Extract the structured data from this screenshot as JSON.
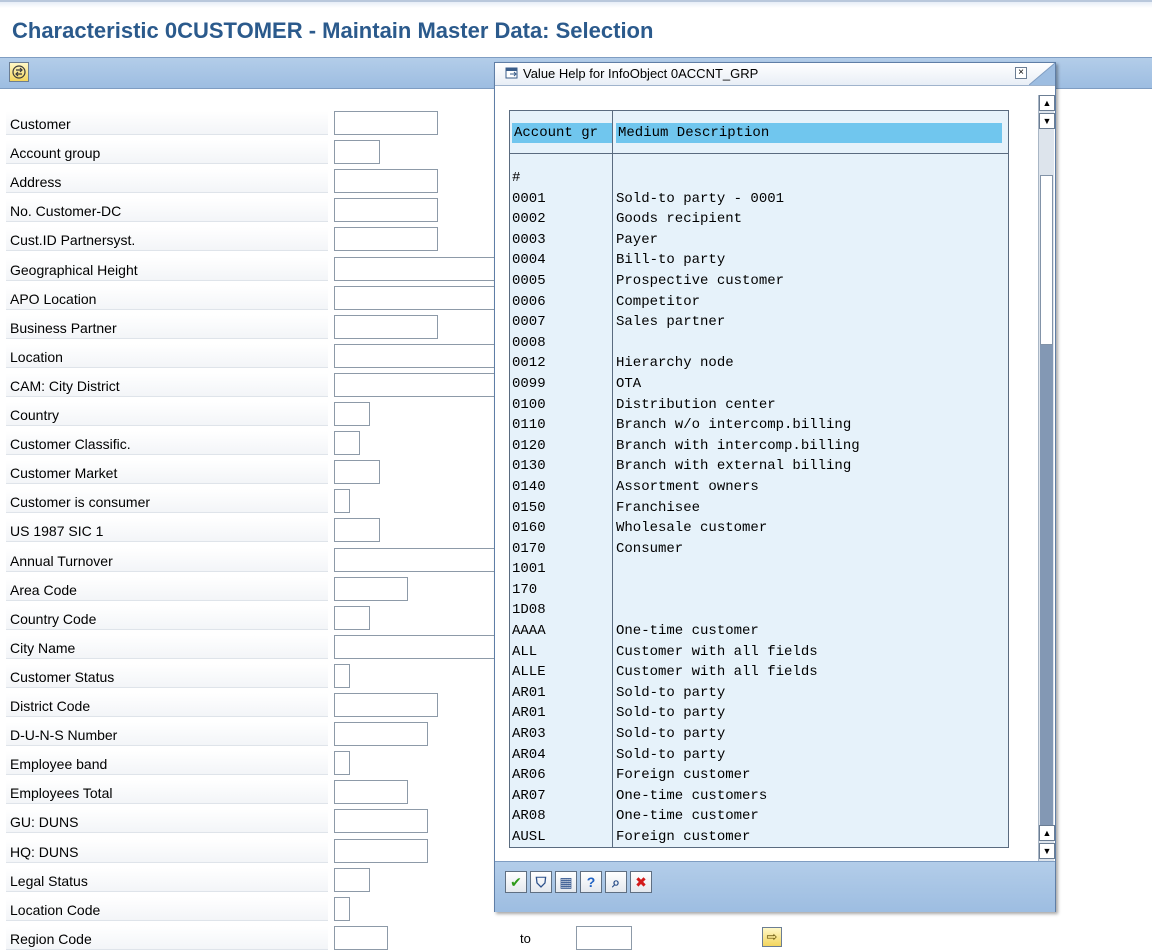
{
  "page": {
    "title": "Characteristic 0CUSTOMER - Maintain Master Data: Selection"
  },
  "toolbar": {
    "execute_icon": "execute-icon"
  },
  "fields": [
    {
      "label": "Customer",
      "w": 104
    },
    {
      "label": "Account group",
      "w": 46
    },
    {
      "label": "Address",
      "w": 104
    },
    {
      "label": "No. Customer-DC",
      "w": 104
    },
    {
      "label": "Cust.ID Partnersyst.",
      "w": 104
    },
    {
      "label": "Geographical Height",
      "w": 170
    },
    {
      "label": "APO Location",
      "w": 170
    },
    {
      "label": "Business Partner",
      "w": 104
    },
    {
      "label": "Location",
      "w": 170
    },
    {
      "label": "CAM: City District",
      "w": 170
    },
    {
      "label": "Country",
      "w": 36
    },
    {
      "label": "Customer Classific.",
      "w": 26
    },
    {
      "label": "Customer Market",
      "w": 46
    },
    {
      "label": "Customer is consumer",
      "w": 16
    },
    {
      "label": "US 1987 SIC 1",
      "w": 46
    },
    {
      "label": "Annual Turnover",
      "w": 170
    },
    {
      "label": "Area Code",
      "w": 74
    },
    {
      "label": "Country Code",
      "w": 36
    },
    {
      "label": "City Name",
      "w": 170
    },
    {
      "label": "Customer Status",
      "w": 16
    },
    {
      "label": "District Code",
      "w": 104
    },
    {
      "label": "D-U-N-S Number",
      "w": 94
    },
    {
      "label": "Employee band",
      "w": 16
    },
    {
      "label": "Employees Total",
      "w": 74
    },
    {
      "label": "GU: DUNS",
      "w": 94
    },
    {
      "label": "HQ: DUNS",
      "w": 94
    },
    {
      "label": "Legal Status",
      "w": 36
    },
    {
      "label": "Location Code",
      "w": 16
    },
    {
      "label": "Region Code",
      "w": 54
    }
  ],
  "region_row": {
    "to_label": "to"
  },
  "dialog": {
    "title": "Value Help for InfoObject 0ACCNT_GRP",
    "close_icon": "close-icon",
    "col1_header": "Account gr",
    "col2_header": "Medium Description",
    "rows": [
      {
        "code": "#",
        "desc": ""
      },
      {
        "code": "0001",
        "desc": "Sold-to party - 0001"
      },
      {
        "code": "0002",
        "desc": "Goods recipient"
      },
      {
        "code": "0003",
        "desc": "Payer"
      },
      {
        "code": "0004",
        "desc": "Bill-to party"
      },
      {
        "code": "0005",
        "desc": "Prospective customer"
      },
      {
        "code": "0006",
        "desc": "Competitor"
      },
      {
        "code": "0007",
        "desc": "Sales partner"
      },
      {
        "code": "0008",
        "desc": ""
      },
      {
        "code": "0012",
        "desc": "Hierarchy node"
      },
      {
        "code": "0099",
        "desc": "OTA"
      },
      {
        "code": "0100",
        "desc": "Distribution center"
      },
      {
        "code": "0110",
        "desc": "Branch w/o intercomp.billing"
      },
      {
        "code": "0120",
        "desc": "Branch with intercomp.billing"
      },
      {
        "code": "0130",
        "desc": "Branch with external billing"
      },
      {
        "code": "0140",
        "desc": "Assortment owners"
      },
      {
        "code": "0150",
        "desc": "Franchisee"
      },
      {
        "code": "0160",
        "desc": "Wholesale customer"
      },
      {
        "code": "0170",
        "desc": "Consumer"
      },
      {
        "code": "1001",
        "desc": ""
      },
      {
        "code": "170",
        "desc": ""
      },
      {
        "code": "1D08",
        "desc": ""
      },
      {
        "code": "AAAA",
        "desc": "One-time customer"
      },
      {
        "code": "ALL",
        "desc": "Customer with all fields"
      },
      {
        "code": "ALLE",
        "desc": "Customer with all fields"
      },
      {
        "code": "AR01",
        "desc": "Sold-to party"
      },
      {
        "code": "AR01",
        "desc": "Sold-to party"
      },
      {
        "code": "AR03",
        "desc": "Sold-to party"
      },
      {
        "code": "AR04",
        "desc": "Sold-to party"
      },
      {
        "code": "AR06",
        "desc": "Foreign customer"
      },
      {
        "code": "AR07",
        "desc": "One-time customers"
      },
      {
        "code": "AR08",
        "desc": "One-time customer"
      },
      {
        "code": "AUSL",
        "desc": "Foreign customer"
      }
    ],
    "footer_buttons": [
      {
        "name": "confirm-button",
        "glyph": "✔",
        "color": "#2e9a1a"
      },
      {
        "name": "filter-button",
        "glyph": "⛉",
        "color": "#2b4f8a"
      },
      {
        "name": "multiple-selection-button",
        "glyph": "▦",
        "color": "#2b4f8a"
      },
      {
        "name": "help-button",
        "glyph": "?",
        "color": "#1f62c4"
      },
      {
        "name": "find-button",
        "glyph": "⌕",
        "color": "#2b4f8a"
      },
      {
        "name": "cancel-button",
        "glyph": "✖",
        "color": "#d31a1a"
      }
    ]
  }
}
